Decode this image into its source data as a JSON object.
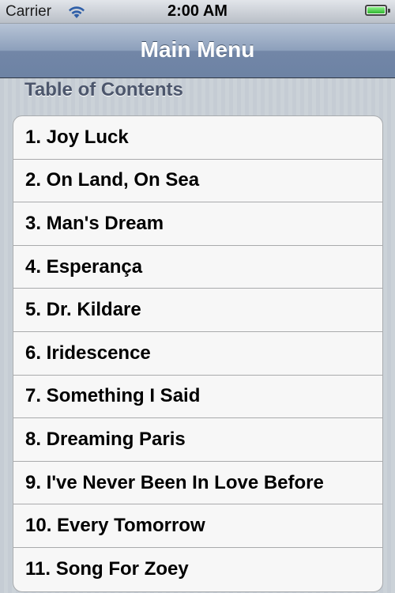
{
  "status_bar": {
    "carrier": "Carrier",
    "time": "2:00 AM",
    "wifi_icon": "wifi-icon",
    "battery_icon": "battery-icon",
    "battery_level": 1.0
  },
  "nav": {
    "title": "Main Menu"
  },
  "section": {
    "header": "Table of Contents"
  },
  "items": [
    {
      "label": "1.  Joy Luck"
    },
    {
      "label": "2.  On Land, On Sea"
    },
    {
      "label": "3.  Man's Dream"
    },
    {
      "label": "4.  Esperança"
    },
    {
      "label": "5.  Dr. Kildare"
    },
    {
      "label": "6.  Iridescence"
    },
    {
      "label": "7.  Something I Said"
    },
    {
      "label": "8.  Dreaming Paris"
    },
    {
      "label": "9.  I've Never Been In Love Before"
    },
    {
      "label": "10.  Every Tomorrow"
    },
    {
      "label": "11.  Song For Zoey"
    }
  ]
}
